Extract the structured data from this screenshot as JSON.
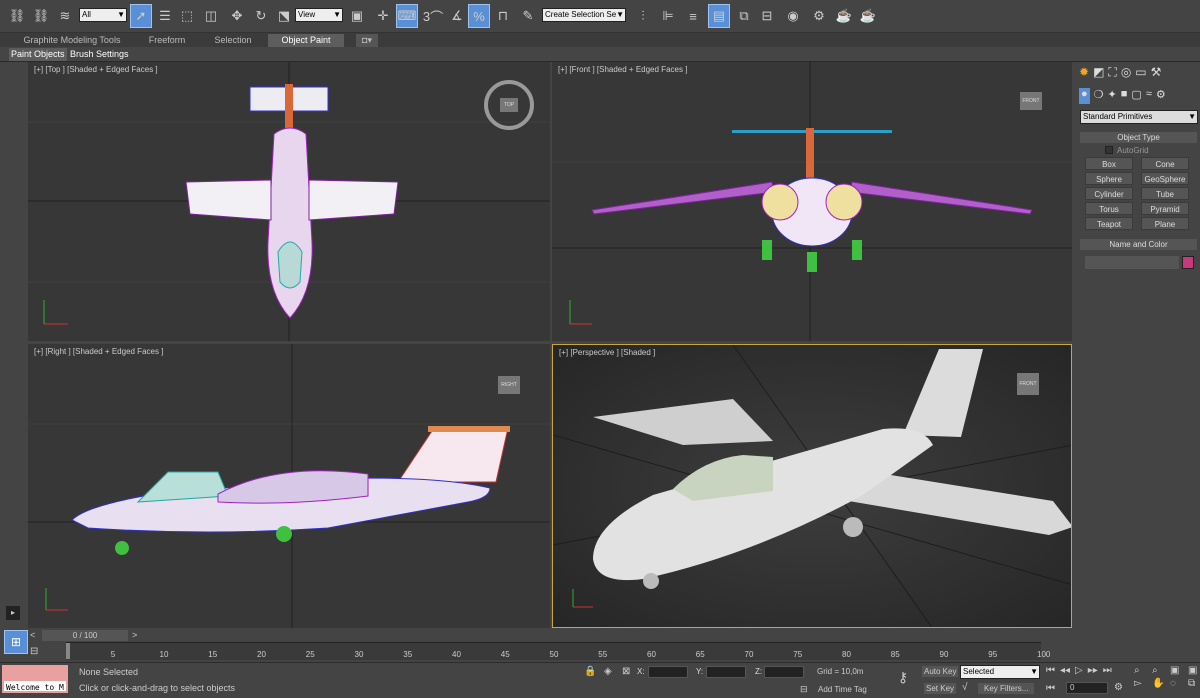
{
  "toolbar": {
    "selection_filter": "All",
    "reference_coord": "View",
    "named_selection_set": "Create Selection Se",
    "snap_angle_label": "3"
  },
  "ribbon": {
    "tabs": [
      "Graphite Modeling Tools",
      "Freeform",
      "Selection",
      "Object Paint"
    ],
    "selected_tab": "Object Paint",
    "sub_buttons": [
      "Paint Objects",
      "Brush Settings"
    ]
  },
  "viewports": {
    "top": "[+] [Top ] [Shaded + Edged Faces ]",
    "front": "[+] [Front ] [Shaded + Edged Faces ]",
    "right": "[+] [Right ] [Shaded + Edged Faces ]",
    "perspective": "[+] [Perspective ] [Shaded ]",
    "viewcube_top": "TOP",
    "viewcube_front": "FRONT",
    "viewcube_right": "RIGHT",
    "viewcube_persp": "FRONT"
  },
  "command_panel": {
    "category": "Standard Primitives",
    "object_type_title": "Object Type",
    "autogrid_label": "AutoGrid",
    "buttons": [
      "Box",
      "Cone",
      "Sphere",
      "GeoSphere",
      "Cylinder",
      "Tube",
      "Torus",
      "Pyramid",
      "Teapot",
      "Plane"
    ],
    "name_color_title": "Name and Color",
    "object_name": "",
    "object_color": "#c8387e"
  },
  "timeline": {
    "frame_slider": "0 / 100",
    "ticks": [
      "0",
      "5",
      "10",
      "15",
      "20",
      "25",
      "30",
      "35",
      "40",
      "45",
      "50",
      "55",
      "60",
      "65",
      "70",
      "75",
      "80",
      "85",
      "90",
      "95",
      "100"
    ]
  },
  "status": {
    "maxscript": "Welcome to M",
    "selection_status": "None Selected",
    "prompt": "Click or click-and-drag to select objects",
    "x_label": "X:",
    "y_label": "Y:",
    "z_label": "Z:",
    "grid": "Grid = 10,0m",
    "add_time_tag": "Add Time Tag",
    "auto_key": "Auto Key",
    "set_key": "Set Key",
    "key_mode": "Selected",
    "key_filters": "Key Filters...",
    "current_frame": "0"
  }
}
